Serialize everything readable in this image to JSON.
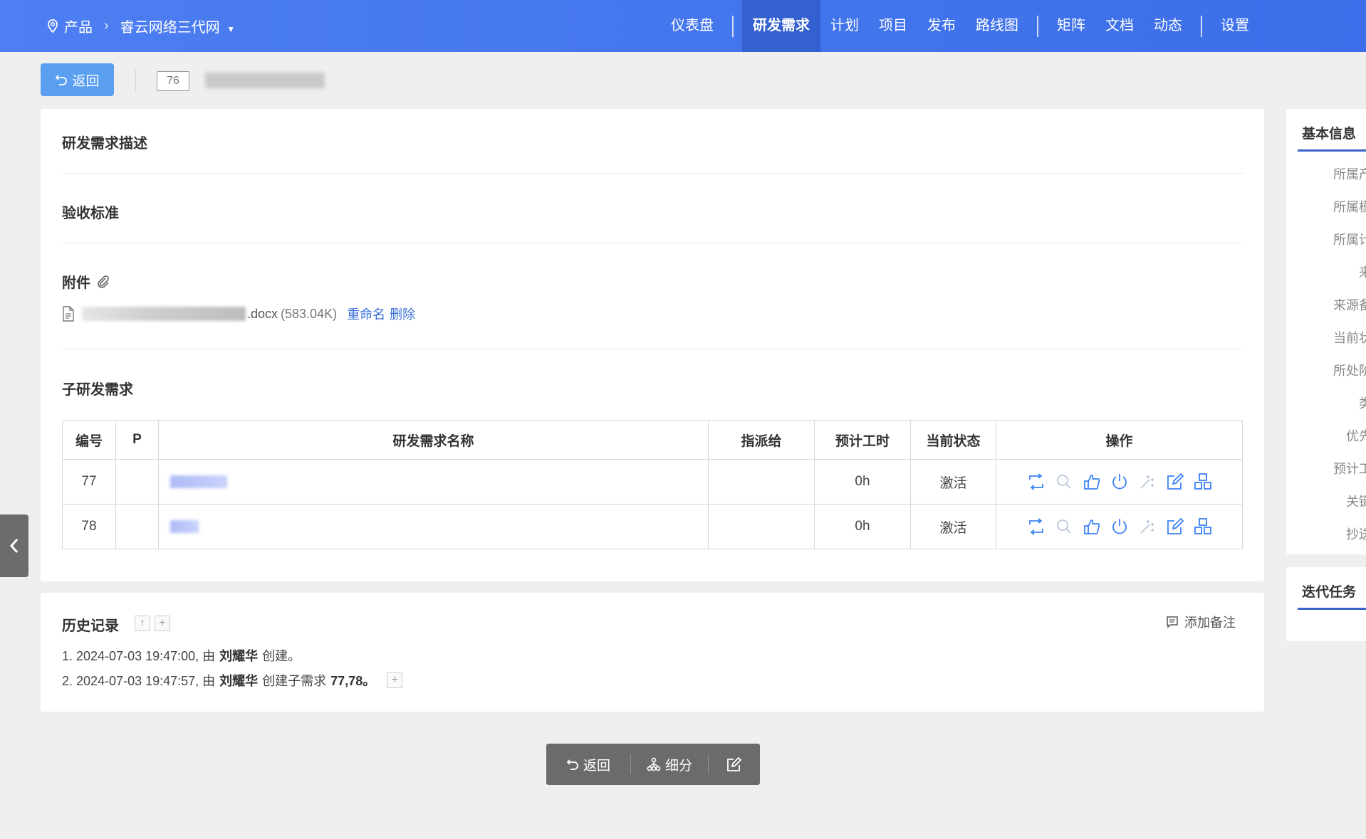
{
  "topbar": {
    "product_label": "产品",
    "project_name": "睿云网络三代网",
    "nav": [
      {
        "label": "仪表盘"
      },
      {
        "label": "研发需求"
      },
      {
        "label": "计划"
      },
      {
        "label": "项目"
      },
      {
        "label": "发布"
      },
      {
        "label": "路线图"
      },
      {
        "label": "矩阵"
      },
      {
        "label": "文档"
      },
      {
        "label": "动态"
      },
      {
        "label": "设置"
      }
    ]
  },
  "header": {
    "back_label": "返回",
    "story_id": "76"
  },
  "sections": {
    "description": "研发需求描述",
    "acceptance": "验收标准",
    "attachments": "附件",
    "children": "子研发需求"
  },
  "attachment": {
    "ext": ".docx",
    "size": "(583.04K)",
    "rename": "重命名",
    "delete": "删除"
  },
  "table": {
    "headers": [
      "编号",
      "P",
      "研发需求名称",
      "指派给",
      "预计工时",
      "当前状态",
      "操作"
    ],
    "rows": [
      {
        "id": "77",
        "pri": "",
        "assigned": "",
        "estimate": "0h",
        "status": "激活"
      },
      {
        "id": "78",
        "pri": "",
        "assigned": "",
        "estimate": "0h",
        "status": "激活"
      }
    ]
  },
  "history": {
    "title": "历史记录",
    "add_note": "添加备注",
    "entries": [
      {
        "prefix": "1. 2024-07-03 19:47:00, 由",
        "user": "刘耀华",
        "action": "创建。",
        "target": ""
      },
      {
        "prefix": "2. 2024-07-03 19:47:57, 由",
        "user": "刘耀华",
        "action": "创建子需求",
        "target": "77,78。"
      }
    ]
  },
  "sidebar": {
    "basic_tab": "基本信息",
    "iteration_tab": "迭代任务",
    "fields": [
      "所属产",
      "所属模",
      "所属计",
      "来",
      "来源备",
      "当前状",
      "所处阶",
      "类",
      "优先",
      "预计工",
      "关键",
      "抄送"
    ]
  },
  "bottom_bar": {
    "back": "返回",
    "split": "细分"
  },
  "colors": {
    "nav_bg": "#4d7ef2",
    "nav_active": "#3560cf",
    "link": "#3a6fd8",
    "action_icon": "#3b82f6"
  }
}
